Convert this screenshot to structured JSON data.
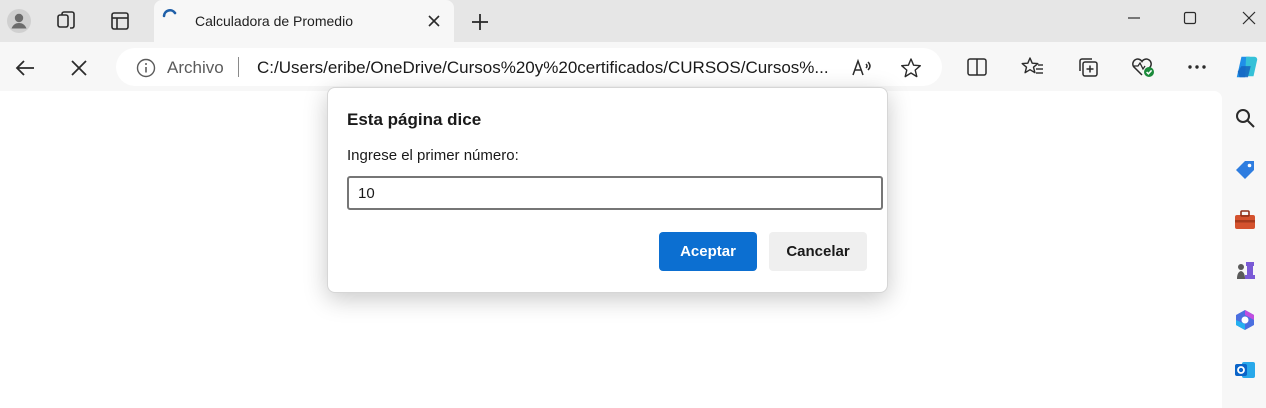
{
  "browser": {
    "tab": {
      "title": "Calculadora de Promedio",
      "loading_icon": "loading-spinner-icon"
    },
    "address_bar": {
      "site_label": "Archivo",
      "url": "C:/Users/eribe/OneDrive/Cursos%20y%20certificados/CURSOS/Cursos%..."
    },
    "accent_color": "#0c6fd1"
  },
  "dialog": {
    "title": "Esta página dice",
    "message": "Ingrese el primer número:",
    "input_value": "10",
    "ok_label": "Aceptar",
    "cancel_label": "Cancelar"
  }
}
